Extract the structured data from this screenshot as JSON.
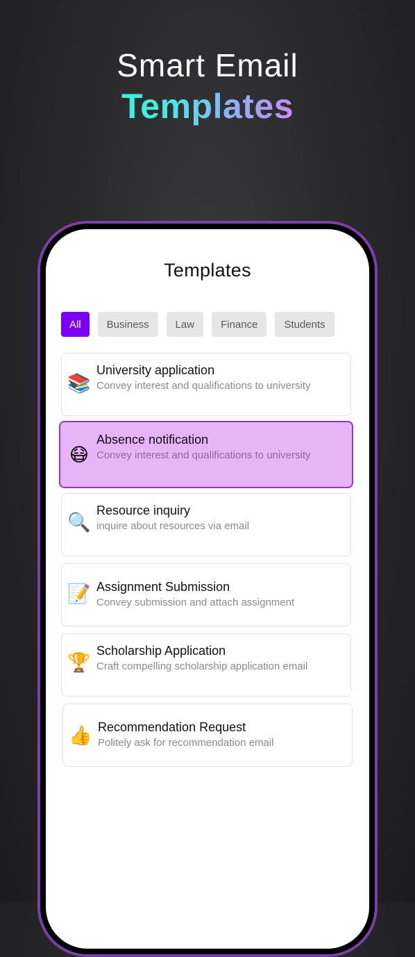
{
  "hero": {
    "line1": "Smart Email",
    "line2": "Templates"
  },
  "screen": {
    "title": "Templates"
  },
  "filters": [
    {
      "label": "All",
      "active": true
    },
    {
      "label": "Business",
      "active": false
    },
    {
      "label": "Law",
      "active": false
    },
    {
      "label": "Finance",
      "active": false
    },
    {
      "label": "Students",
      "active": false
    }
  ],
  "templates": [
    {
      "icon": "books-icon",
      "emoji": "📚",
      "title": "University application",
      "description": "Convey interest and qualifications to university",
      "selected": false
    },
    {
      "icon": "medical-mask-face-icon",
      "emoji": "😷",
      "title": "Absence notification",
      "description": "Convey interest and qualifications to university",
      "selected": true
    },
    {
      "icon": "magnifying-glass-icon",
      "emoji": "🔍",
      "title": "Resource inquiry",
      "description": "inquire about resources via email",
      "selected": false
    },
    {
      "icon": "memo-icon",
      "emoji": "📝",
      "title": "Assignment Submission",
      "description": "Convey submission and attach assignment",
      "selected": false
    },
    {
      "icon": "trophy-icon",
      "emoji": "🏆",
      "title": "Scholarship Application",
      "description": "Craft compelling scholarship application email",
      "selected": false
    },
    {
      "icon": "thumbs-up-icon",
      "emoji": "👍",
      "title": "Recommendation Request",
      "description": "Politely ask for recommendation email",
      "selected": false
    }
  ],
  "colors": {
    "accent": "#7a00f5",
    "selected_bg": "#e6b4f7",
    "selected_border": "#8f3ab6",
    "phone_frame": "#7a3fa8"
  }
}
